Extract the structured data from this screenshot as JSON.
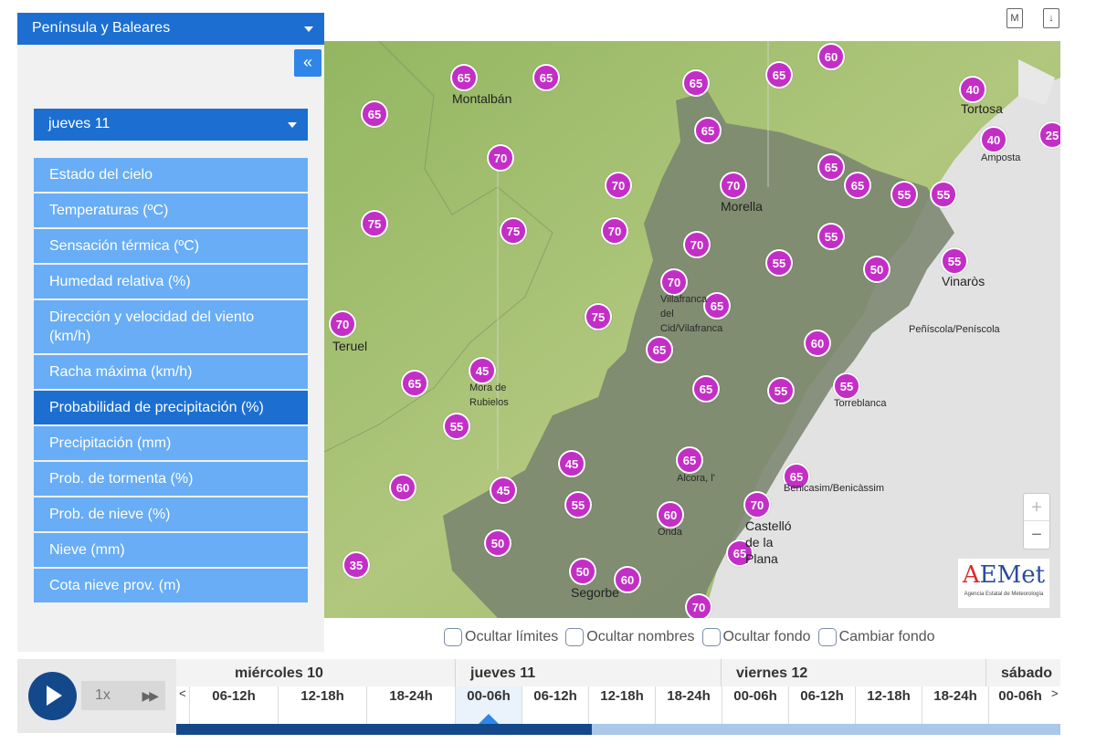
{
  "header": {
    "icons": [
      "map-icon",
      "download-icon"
    ],
    "map_icon_label": "M",
    "download_icon_label": "↓"
  },
  "sidebar": {
    "region": "Península y Baleares",
    "collapse": "«",
    "day": "jueves 11",
    "items": [
      {
        "label": "Estado del cielo",
        "active": false
      },
      {
        "label": "Temperaturas (ºC)",
        "active": false
      },
      {
        "label": "Sensación térmica (ºC)",
        "active": false
      },
      {
        "label": "Humedad relativa (%)",
        "active": false
      },
      {
        "label": "Dirección y velocidad del viento (km/h)",
        "active": false
      },
      {
        "label": "Racha máxima (km/h)",
        "active": false
      },
      {
        "label": "Probabilidad de precipitación (%)",
        "active": true
      },
      {
        "label": "Precipitación (mm)",
        "active": false
      },
      {
        "label": "Prob. de tormenta (%)",
        "active": false
      },
      {
        "label": "Prob. de nieve (%)",
        "active": false
      },
      {
        "label": "Nieve (mm)",
        "active": false
      },
      {
        "label": "Cota nieve prov. (m)",
        "active": false
      }
    ]
  },
  "map": {
    "values": [
      "65",
      "65",
      "65",
      "65",
      "60",
      "65",
      "40",
      "65",
      "40",
      "25",
      "70",
      "65",
      "65",
      "70",
      "70",
      "55",
      "55",
      "75",
      "75",
      "70",
      "70",
      "55",
      "70",
      "55",
      "50",
      "55",
      "70",
      "65",
      "65",
      "75",
      "65",
      "60",
      "65",
      "45",
      "65",
      "55",
      "55",
      "55",
      "45",
      "65",
      "60",
      "45",
      "55",
      "60",
      "70",
      "50",
      "35",
      "50",
      "60",
      "65",
      "70",
      "65"
    ],
    "places": {
      "montalban": "Montalbán",
      "tortosa": "Tortosa",
      "amposta": "Amposta",
      "morella": "Morella",
      "vinaros": "Vinaròs",
      "villafranca": "Villafranca\ndel\nCid/Vilafranca",
      "peniscola": "Peñíscola/Peníscola",
      "teruel": "Teruel",
      "mora": "Mora de\nRubielos",
      "torreblanca": "Torreblanca",
      "alcora": "Alcora, l'",
      "benicasim": "Benicasim/Benicàssim",
      "onda": "Onda",
      "castello": "Castelló\nde la\nPlana",
      "segorbe": "Segorbe"
    },
    "zoom_in": "+",
    "zoom_out": "−",
    "logo": {
      "main_a": "A",
      "main_rest": "EMet",
      "sub": "Agencia Estatal de Meteorología"
    },
    "colors": {
      "pin": "#c32fc6",
      "land": "#a7c276",
      "region": "#76806c",
      "sea": "#e3e3e3"
    }
  },
  "options": [
    {
      "label": "Ocultar límites"
    },
    {
      "label": "Ocultar nombres"
    },
    {
      "label": "Ocultar fondo"
    },
    {
      "label": "Cambiar fondo"
    }
  ],
  "player": {
    "speed": "1x",
    "ff": "▶▶"
  },
  "timeline": {
    "days": [
      "miércoles 10",
      "jueves 11",
      "viernes 12",
      "sábado"
    ],
    "slots": [
      "06-12h",
      "12-18h",
      "18-24h",
      "00-06h",
      "06-12h",
      "12-18h",
      "18-24h",
      "00-06h",
      "06-12h",
      "12-18h",
      "18-24h",
      "00-06h"
    ],
    "active_slot": 3,
    "progress": 0.47,
    "left_arrow": "<",
    "right_arrow": ">"
  }
}
